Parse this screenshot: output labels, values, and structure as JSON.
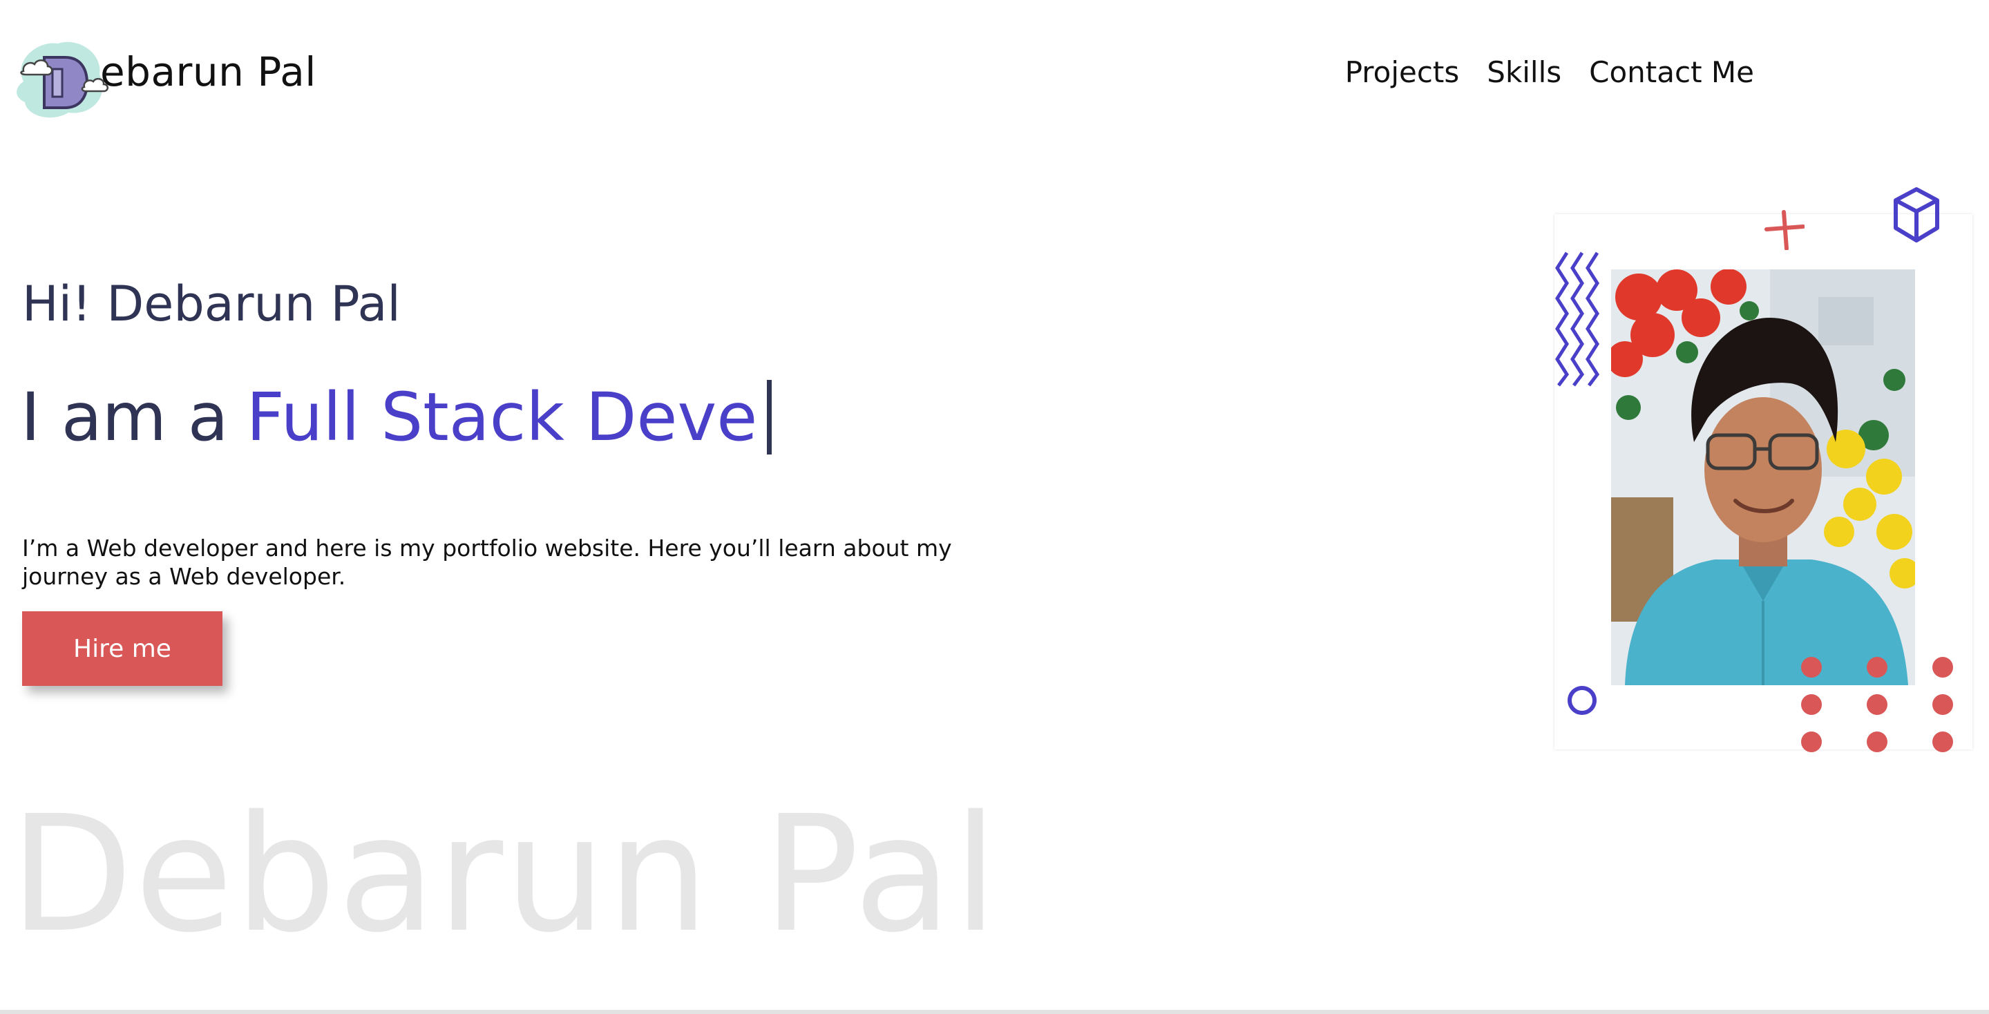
{
  "header": {
    "logo_text": "ebarun Pal",
    "logo_initial": "D",
    "nav": [
      {
        "label": "Projects"
      },
      {
        "label": "Skills"
      },
      {
        "label": "Contact Me"
      }
    ]
  },
  "hero": {
    "greeting": "Hi! Debarun Pal",
    "headline_prefix": "I am a",
    "headline_role": "Full Stack Deve",
    "intro": "I’m a Web developer and here is my portfolio website. Here you’ll learn about my journey as a Web developer.",
    "hire_label": "Hire me",
    "watermark": "Debarun Pal"
  },
  "colors": {
    "accent_purple": "#4a3fc9",
    "accent_red": "#d95757",
    "heading_navy": "#2f3454",
    "watermark_gray": "#e6e6e6"
  },
  "icons": {
    "logo": "cloud-letter-d-logo-icon",
    "decor": [
      "plus-icon",
      "cube-icon",
      "zigzag-icon",
      "circle-icon",
      "dot-grid-icon"
    ]
  }
}
